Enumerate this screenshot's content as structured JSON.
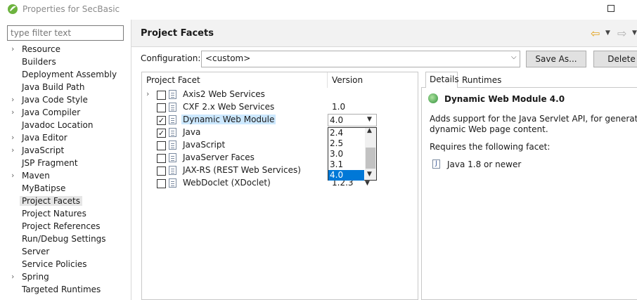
{
  "window": {
    "title": "Properties for SecBasic"
  },
  "filter": {
    "placeholder": "type filter text"
  },
  "nav": {
    "items": [
      {
        "label": "Resource",
        "expandable": true
      },
      {
        "label": "Builders",
        "expandable": false
      },
      {
        "label": "Deployment Assembly",
        "expandable": false
      },
      {
        "label": "Java Build Path",
        "expandable": false
      },
      {
        "label": "Java Code Style",
        "expandable": true
      },
      {
        "label": "Java Compiler",
        "expandable": true
      },
      {
        "label": "Javadoc Location",
        "expandable": false
      },
      {
        "label": "Java Editor",
        "expandable": true
      },
      {
        "label": "JavaScript",
        "expandable": true
      },
      {
        "label": "JSP Fragment",
        "expandable": false
      },
      {
        "label": "Maven",
        "expandable": true
      },
      {
        "label": "MyBatipse",
        "expandable": false
      },
      {
        "label": "Project Facets",
        "expandable": false,
        "selected": true
      },
      {
        "label": "Project Natures",
        "expandable": false
      },
      {
        "label": "Project References",
        "expandable": false
      },
      {
        "label": "Run/Debug Settings",
        "expandable": false
      },
      {
        "label": "Server",
        "expandable": false
      },
      {
        "label": "Service Policies",
        "expandable": false
      },
      {
        "label": "Spring",
        "expandable": true
      },
      {
        "label": "Targeted Runtimes",
        "expandable": false
      }
    ]
  },
  "header": {
    "title": "Project Facets"
  },
  "config": {
    "label": "Configuration:",
    "value": "<custom>",
    "save_as": "Save As...",
    "delete": "Delete"
  },
  "facets": {
    "col_facet": "Project Facet",
    "col_version": "Version",
    "rows": [
      {
        "name": "Axis2 Web Services",
        "checked": false,
        "expandable": true,
        "version": ""
      },
      {
        "name": "CXF 2.x Web Services",
        "checked": false,
        "expandable": false,
        "version": "1.0"
      },
      {
        "name": "Dynamic Web Module",
        "checked": true,
        "expandable": false,
        "version": "4.0",
        "selected": true
      },
      {
        "name": "Java",
        "checked": true,
        "expandable": false,
        "version": ""
      },
      {
        "name": "JavaScript",
        "checked": false,
        "expandable": false,
        "version": ""
      },
      {
        "name": "JavaServer Faces",
        "checked": false,
        "expandable": false,
        "version": ""
      },
      {
        "name": "JAX-RS (REST Web Services)",
        "checked": false,
        "expandable": false,
        "version": ""
      },
      {
        "name": "WebDoclet (XDoclet)",
        "checked": false,
        "expandable": false,
        "version": "1.2.3"
      }
    ],
    "version_combo_value": "4.0",
    "dropdown_options": [
      "2.4",
      "2.5",
      "3.0",
      "3.1",
      "4.0"
    ],
    "dropdown_selected": "4.0"
  },
  "details": {
    "tabs": [
      "Details",
      "Runtimes"
    ],
    "title": "Dynamic Web Module 4.0",
    "desc_line1": "Adds support for the Java Servlet API, for generation of",
    "desc_line2": "dynamic Web page content.",
    "requires": "Requires the following facet:",
    "req_item": "Java 1.8 or newer",
    "req_icon_glyph": "J"
  },
  "colors": {
    "selection": "#cce8ff",
    "dropdown_selection": "#0078d7",
    "nav_selection": "#e5e5e5",
    "back_arrow": "#e3a21a"
  }
}
